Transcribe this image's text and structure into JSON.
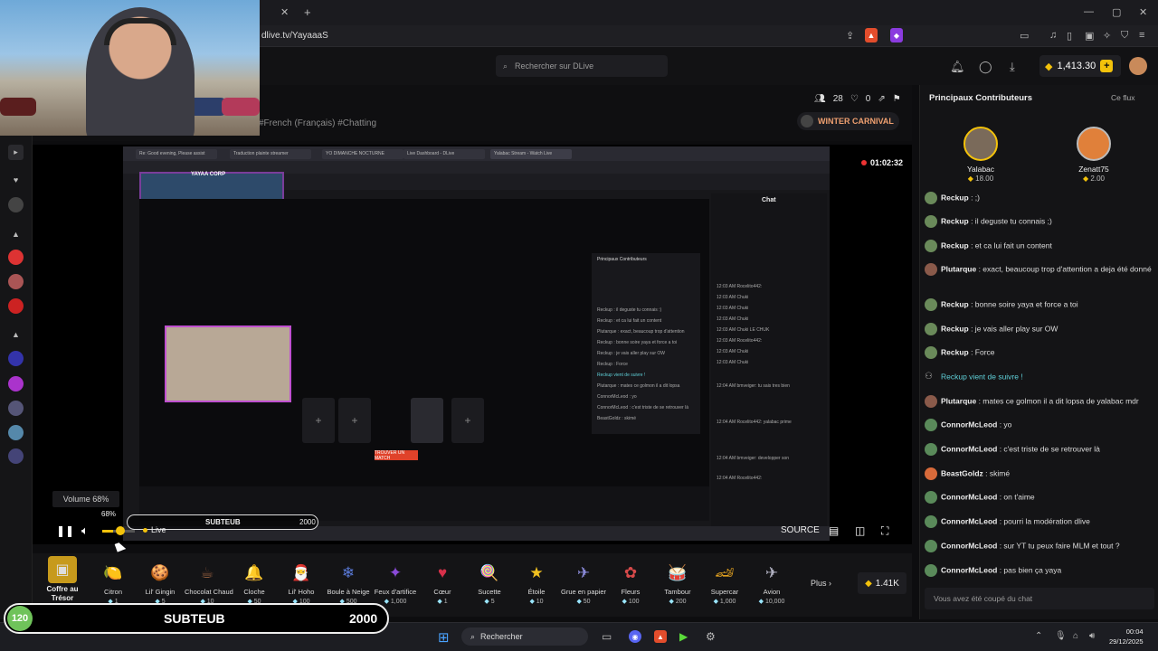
{
  "browser": {
    "url": "dlive.tv/YayaaaS",
    "tab_close": "✕",
    "new_tab": "+",
    "win_min": "—",
    "win_max": "▢",
    "win_close": "✕"
  },
  "header": {
    "search_placeholder": "Rechercher sur DLive",
    "balance": "1,413.30",
    "plus": "+"
  },
  "stream": {
    "tags": "#French (Français)  #Chatting",
    "viewers": "28",
    "likes": "0",
    "winter": "WINTER CARNIVAL",
    "timer": "01:02:32"
  },
  "nested": {
    "tabs": [
      "Re: Good evening, Please assist",
      "Traduction plainte streamer",
      "YO DIMANCHE NOCTURNE",
      "Live Dashboard - DLive",
      "Yalabac Stream - Watch Live"
    ],
    "yayaa_corp": "YAYAA CORP",
    "chat_title": "Chat",
    "contrib_title": "Principaux Contributeurs",
    "red_button": "TROUVER UN MATCH",
    "chat_lines": [
      "Reckup : il deguste tu connais :)",
      "Reckup : et ca lui fait un content",
      "Plutarque : exact, beaucoup trop d'attention",
      "Reckup : bonne soire yaya et force a toi",
      "Reckup : je vais aller play sur OW",
      "Reckup : Force",
      "Reckup vient de suivre !",
      "Plutarque : mates ce golmon il a dit lopsa",
      "ConnorMcLeod : yo",
      "ConnorMcLeod : c'est triste de se retrouver là",
      "BeastGoldz : skimé",
      "ConnorMcLeod : on t'aime",
      "ConnorMcLeod : pourri la modération",
      "ConnorMcLeod : sur YT tu peux faire MLM",
      "ConnorMcLeod : pas bien ça yaya"
    ],
    "right_lines": [
      "12:03 AM Rocelito442:",
      "12:03 AM Chuki",
      "12:03 AM Chuki",
      "12:03 AM Chuki",
      "12:03 AM Chuki LE CHUK",
      "12:03 AM Rocelito442:",
      "12:03 AM Chuki",
      "12:03 AM Chuki",
      "12:04 AM bmveiger: tu sais tres bien",
      "12:04 AM Rocelito442: yalabac prime",
      "12:04 AM bmveiger: developper son",
      "12:04 AM Rocelito442:"
    ]
  },
  "player": {
    "volume_tip": "Volume 68%",
    "volume_pct": 68,
    "live": "Live",
    "source": "SOURCE"
  },
  "banner": {
    "pct": "120",
    "small_pct": "68%",
    "name": "SUBTEUB",
    "goal": "2000"
  },
  "gifts": {
    "coffre": "Coffre au Trésor",
    "items": [
      {
        "name": "Citron",
        "price": "1",
        "icon": "🍋",
        "color": "#f5d020"
      },
      {
        "name": "Lil' Gingin",
        "price": "5",
        "icon": "🍪",
        "color": "#c8782c"
      },
      {
        "name": "Chocolat Chaud",
        "price": "10",
        "icon": "☕",
        "color": "#8c5a3c"
      },
      {
        "name": "Cloche",
        "price": "50",
        "icon": "🔔",
        "color": "#d86a2a"
      },
      {
        "name": "Lil' Hoho",
        "price": "100",
        "icon": "🎅",
        "color": "#d43c3c"
      },
      {
        "name": "Boule à Neige",
        "price": "500",
        "icon": "❄",
        "color": "#5a7ad8"
      },
      {
        "name": "Feux d'artifice",
        "price": "1,000",
        "icon": "✦",
        "color": "#8a4ad8"
      },
      {
        "name": "Cœur",
        "price": "1",
        "icon": "♥",
        "color": "#d8304a"
      },
      {
        "name": "Sucette",
        "price": "5",
        "icon": "🍭",
        "color": "#e06a9a"
      },
      {
        "name": "Étoile",
        "price": "10",
        "icon": "★",
        "color": "#f0c020"
      },
      {
        "name": "Grue en papier",
        "price": "50",
        "icon": "✈",
        "color": "#8a8ad8"
      },
      {
        "name": "Fleurs",
        "price": "100",
        "icon": "✿",
        "color": "#d84a4a"
      },
      {
        "name": "Tambour",
        "price": "200",
        "icon": "🥁",
        "color": "#c88a3c"
      },
      {
        "name": "Supercar",
        "price": "1,000",
        "icon": "🏎",
        "color": "#e0a020"
      },
      {
        "name": "Avion",
        "price": "10,000",
        "icon": "✈",
        "color": "#b0b0c0"
      }
    ],
    "plus": "Plus ›",
    "balance": "1.41K"
  },
  "chat": {
    "contrib_title": "Principaux Contributeurs",
    "ce_flux": "Ce flux",
    "contributors": [
      {
        "name": "Yalabac",
        "amount": "18.00"
      },
      {
        "name": "Zenatt75",
        "amount": "2.00"
      }
    ],
    "lines": [
      {
        "user": "Reckup",
        "text": " : ;)"
      },
      {
        "user": "Reckup",
        "text": " : il deguste tu connais ;)"
      },
      {
        "user": "Reckup",
        "text": " : et ca lui fait un content"
      },
      {
        "user": "Plutarque",
        "text": " : exact, beaucoup trop d'attention a deja été donné"
      },
      {
        "user": "Reckup",
        "text": " : bonne soire yaya et force a toi"
      },
      {
        "user": "Reckup",
        "text": " : je vais aller play sur OW"
      },
      {
        "user": "Reckup",
        "text": " : Force"
      },
      {
        "follow": "Reckup vient de suivre !"
      },
      {
        "user": "Plutarque",
        "text": " : mates ce golmon il a dit lopsa de yalabac mdr"
      },
      {
        "user": "ConnorMcLeod",
        "text": " : yo"
      },
      {
        "user": "ConnorMcLeod",
        "text": " : c'est triste de se retrouver là"
      },
      {
        "user": "BeastGoldz",
        "text": " : skimé"
      },
      {
        "user": "ConnorMcLeod",
        "text": " : on t'aime"
      },
      {
        "user": "ConnorMcLeod",
        "text": " : pourri la modération dlive"
      },
      {
        "user": "ConnorMcLeod",
        "text": " : sur YT tu peux faire MLM et tout ?"
      },
      {
        "user": "ConnorMcLeod",
        "text": " : pas bien ça yaya"
      }
    ],
    "banned": "Vous avez été coupé du chat"
  },
  "taskbar": {
    "search": "Rechercher",
    "time": "00:04",
    "date": "29/12/2025"
  }
}
